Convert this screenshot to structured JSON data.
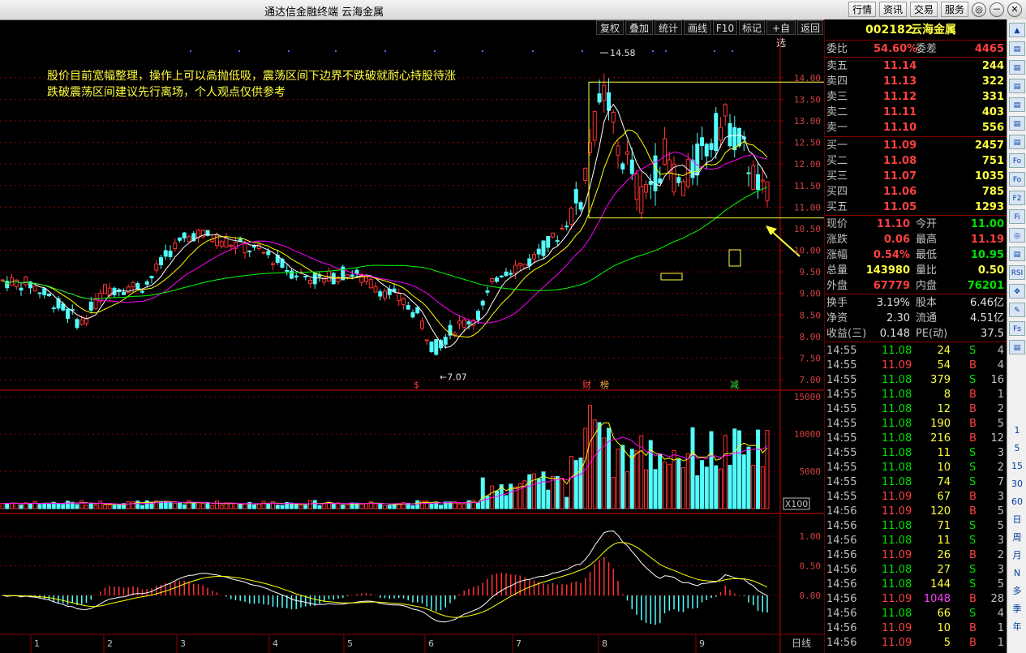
{
  "window": {
    "title": "通达信金融终端  云海金属",
    "menu": [
      "行情",
      "资讯",
      "交易",
      "服务"
    ],
    "controls": [
      "◎",
      "－",
      "✕"
    ]
  },
  "toolbar": [
    "复权",
    "叠加",
    "统计",
    "画线",
    "F10",
    "标记",
    "+自选",
    "返回"
  ],
  "annotation": {
    "line1": "股价目前宽幅整理，操作上可以高抛低吸，震荡区间下边界不跌破就耐心持股待涨",
    "line2": "跌破震荡区间建议先行离场，个人观点仅供参考"
  },
  "chart_labels": {
    "high_marker": "14.58",
    "low_marker": "7.07",
    "tags": [
      "$",
      "财",
      "榜",
      "减"
    ],
    "vol_unit": "X100",
    "period": "日线"
  },
  "colors": {
    "up": "#ff3232",
    "down": "#54fcfc",
    "ma5": "#ffffff",
    "ma10": "#ffff00",
    "ma20": "#ff00ff",
    "ma60": "#00ff00",
    "grid": "#8b0000"
  },
  "chart_data": {
    "type": "candlestick",
    "price_axis": [
      "14.00",
      "13.50",
      "13.00",
      "12.50",
      "12.00",
      "11.50",
      "11.00",
      "10.50",
      "10.00",
      "9.50",
      "9.00",
      "8.50",
      "8.00",
      "7.50",
      "7.00"
    ],
    "volume_axis": [
      "15000",
      "10000",
      "5000"
    ],
    "macd_axis": [
      "1.00",
      "0.50",
      "0.00"
    ],
    "months": [
      "1",
      "2",
      "3",
      "4",
      "5",
      "6",
      "7",
      "8",
      "9"
    ],
    "ylim": [
      7.0,
      14.6
    ],
    "high": 14.58,
    "low": 7.07
  },
  "quote": {
    "code": "002182",
    "name": "云海金属",
    "weibi_label": "委比",
    "weibi": "54.60%",
    "weicha_label": "委差",
    "weicha": "4465",
    "asks": [
      {
        "label": "卖五",
        "price": "11.14",
        "vol": "244"
      },
      {
        "label": "卖四",
        "price": "11.13",
        "vol": "322"
      },
      {
        "label": "卖三",
        "price": "11.12",
        "vol": "331"
      },
      {
        "label": "卖二",
        "price": "11.11",
        "vol": "403"
      },
      {
        "label": "卖一",
        "price": "11.10",
        "vol": "556"
      }
    ],
    "bids": [
      {
        "label": "买一",
        "price": "11.09",
        "vol": "2457"
      },
      {
        "label": "买二",
        "price": "11.08",
        "vol": "751"
      },
      {
        "label": "买三",
        "price": "11.07",
        "vol": "1035"
      },
      {
        "label": "买四",
        "price": "11.06",
        "vol": "785"
      },
      {
        "label": "买五",
        "price": "11.05",
        "vol": "1293"
      }
    ],
    "stats1": [
      {
        "l1": "现价",
        "v1": "11.10",
        "l2": "今开",
        "v2": "11.00"
      },
      {
        "l1": "涨跌",
        "v1": "0.06",
        "l2": "最高",
        "v2": "11.19"
      },
      {
        "l1": "涨幅",
        "v1": "0.54%",
        "l2": "最低",
        "v2": "10.95"
      },
      {
        "l1": "总量",
        "v1": "143980",
        "l2": "量比",
        "v2": "0.50"
      },
      {
        "l1": "外盘",
        "v1": "67779",
        "l2": "内盘",
        "v2": "76201"
      }
    ],
    "stats2": [
      {
        "l1": "换手",
        "v1": "3.19%",
        "l2": "股本",
        "v2": "6.46亿"
      },
      {
        "l1": "净资",
        "v1": "2.30",
        "l2": "流通",
        "v2": "4.51亿"
      },
      {
        "l1": "收益(三)",
        "v1": "0.148",
        "l2": "PE(动)",
        "v2": "37.5"
      }
    ],
    "ticks": [
      {
        "t": "14:55",
        "p": "11.08",
        "v": "24",
        "s": "S",
        "n": "4"
      },
      {
        "t": "14:55",
        "p": "11.09",
        "v": "54",
        "s": "B",
        "n": "4"
      },
      {
        "t": "14:55",
        "p": "11.08",
        "v": "379",
        "s": "S",
        "n": "16"
      },
      {
        "t": "14:55",
        "p": "11.08",
        "v": "8",
        "s": "B",
        "n": "1"
      },
      {
        "t": "14:55",
        "p": "11.08",
        "v": "12",
        "s": "B",
        "n": "2"
      },
      {
        "t": "14:55",
        "p": "11.08",
        "v": "190",
        "s": "B",
        "n": "5"
      },
      {
        "t": "14:55",
        "p": "11.08",
        "v": "216",
        "s": "B",
        "n": "12"
      },
      {
        "t": "14:55",
        "p": "11.08",
        "v": "11",
        "s": "S",
        "n": "3"
      },
      {
        "t": "14:55",
        "p": "11.08",
        "v": "10",
        "s": "S",
        "n": "2"
      },
      {
        "t": "14:55",
        "p": "11.08",
        "v": "74",
        "s": "S",
        "n": "7"
      },
      {
        "t": "14:55",
        "p": "11.09",
        "v": "67",
        "s": "B",
        "n": "3"
      },
      {
        "t": "14:56",
        "p": "11.09",
        "v": "120",
        "s": "B",
        "n": "5"
      },
      {
        "t": "14:56",
        "p": "11.08",
        "v": "71",
        "s": "S",
        "n": "5"
      },
      {
        "t": "14:56",
        "p": "11.08",
        "v": "11",
        "s": "S",
        "n": "3"
      },
      {
        "t": "14:56",
        "p": "11.09",
        "v": "26",
        "s": "B",
        "n": "2"
      },
      {
        "t": "14:56",
        "p": "11.08",
        "v": "27",
        "s": "S",
        "n": "3"
      },
      {
        "t": "14:56",
        "p": "11.08",
        "v": "144",
        "s": "S",
        "n": "5"
      },
      {
        "t": "14:56",
        "p": "11.09",
        "v": "1048",
        "s": "B",
        "n": "28"
      },
      {
        "t": "14:56",
        "p": "11.08",
        "v": "66",
        "s": "S",
        "n": "4"
      },
      {
        "t": "14:56",
        "p": "11.09",
        "v": "10",
        "s": "B",
        "n": "1"
      },
      {
        "t": "14:56",
        "p": "11.09",
        "v": "5",
        "s": "B",
        "n": "1"
      }
    ]
  },
  "sidebar": [
    "1",
    "5",
    "15",
    "30",
    "60",
    "日",
    "周",
    "月",
    "N",
    "多",
    "季",
    "年"
  ],
  "sidebar_icons": [
    "▲",
    "▤",
    "▤",
    "▤",
    "▤",
    "▤",
    "▤",
    "Fo",
    "Fo",
    "F2",
    "Fi",
    "◎",
    "▤",
    "RSI",
    "✥",
    "✎",
    "Fs",
    "▤"
  ]
}
